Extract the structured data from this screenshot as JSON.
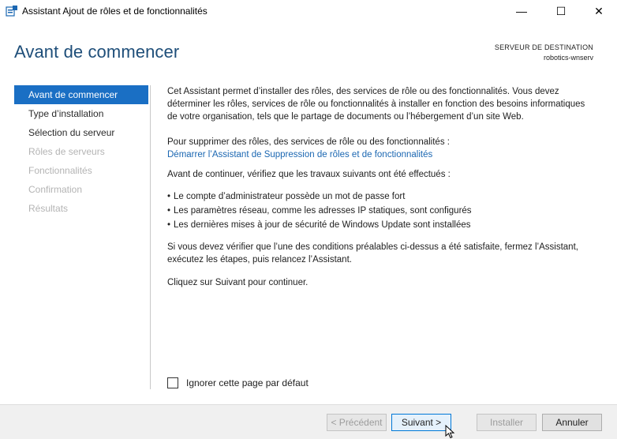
{
  "window": {
    "title": "Assistant Ajout de rôles et de fonctionnalités",
    "controls": {
      "minimize": "—",
      "maximize": "☐",
      "close": "✕"
    }
  },
  "header": {
    "page_title": "Avant de commencer",
    "destination_label": "SERVEUR DE DESTINATION",
    "destination_server": "robotics-wnserv"
  },
  "nav": {
    "items": [
      {
        "label": "Avant de commencer",
        "state": "active"
      },
      {
        "label": "Type d’installation",
        "state": "enabled"
      },
      {
        "label": "Sélection du serveur",
        "state": "enabled"
      },
      {
        "label": "Rôles de serveurs",
        "state": "disabled"
      },
      {
        "label": "Fonctionnalités",
        "state": "disabled"
      },
      {
        "label": "Confirmation",
        "state": "disabled"
      },
      {
        "label": "Résultats",
        "state": "disabled"
      }
    ]
  },
  "content": {
    "intro_line1": "Cet Assistant permet d’installer des rôles, des services de rôle ou des fonctionnalités. Vous devez",
    "intro_line2": "déterminer les rôles, services de rôle ou fonctionnalités à installer en fonction des besoins informatiques",
    "intro_line3": "de votre organisation, tels que le partage de documents ou l’hébergement d’un site Web.",
    "remove_text": "Pour supprimer des rôles, des services de rôle ou des fonctionnalités :",
    "remove_link": "Démarrer l’Assistant de Suppression de rôles et de fonctionnalités",
    "check_text": "Avant de continuer, vérifiez que les travaux suivants ont été effectués :",
    "bullets": [
      "Le compte d’administrateur possède un mot de passe fort",
      "Les paramètres réseau, comme les adresses IP statiques, sont configurés",
      "Les dernières mises à jour de sécurité de Windows Update sont installées"
    ],
    "verify_line1": "Si vous devez vérifier que l’une des conditions préalables ci-dessus a été satisfaite, fermez l’Assistant,",
    "verify_line2": "exécutez les étapes, puis relancez l’Assistant.",
    "next_text": "Cliquez sur Suivant pour continuer."
  },
  "skip_checkbox": {
    "label": "Ignorer cette page par défaut",
    "checked": false
  },
  "footer": {
    "prev_label": "< Précédent",
    "next_label": "Suivant >",
    "install_label": "Installer",
    "cancel_label": "Annuler"
  },
  "colors": {
    "accent": "#1a6fc4",
    "title": "#1e4e79",
    "link": "#1b67b2"
  }
}
